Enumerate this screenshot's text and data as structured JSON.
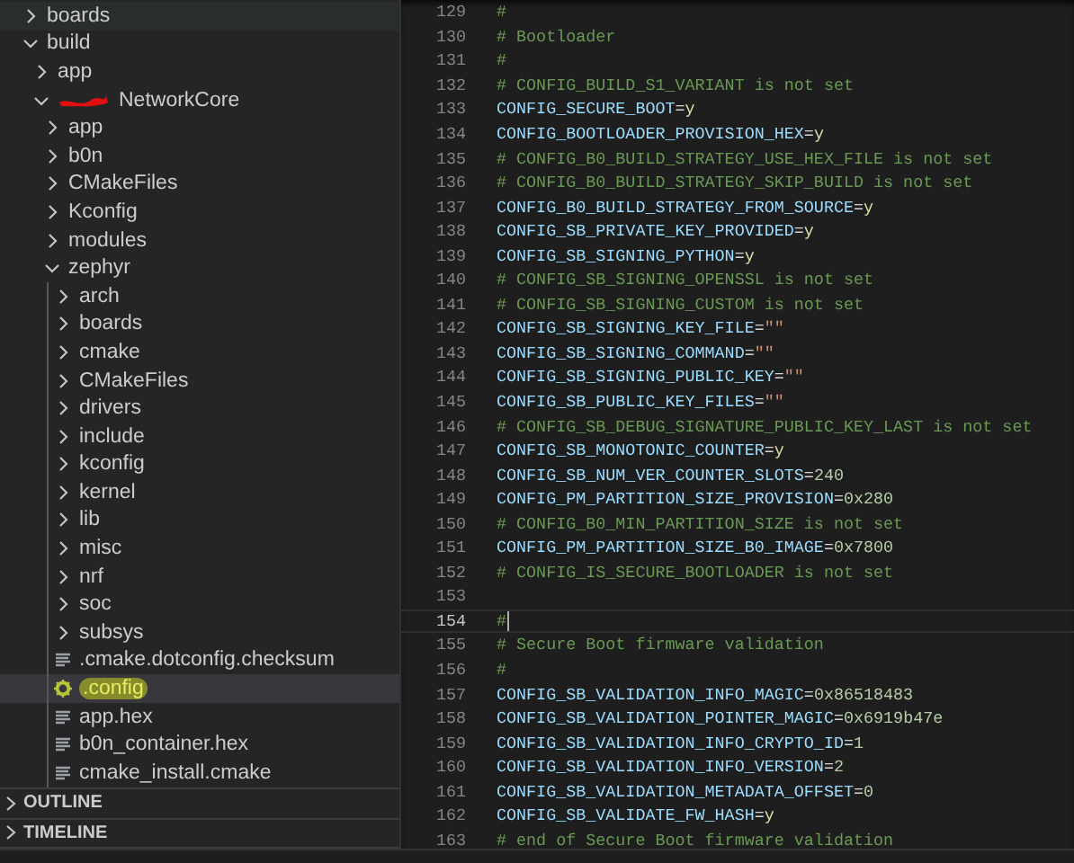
{
  "explorer": {
    "tree": [
      {
        "label": "boards",
        "kind": "folder",
        "expanded": false,
        "hovered": true,
        "selected": false
      },
      {
        "label": "build",
        "kind": "folder",
        "expanded": true,
        "selected": false,
        "children": [
          {
            "label": "app",
            "kind": "folder",
            "expanded": false,
            "selected": false
          },
          {
            "label": "NetworkCore",
            "kind": "folder",
            "expanded": true,
            "redacted": true,
            "selected": false,
            "children": [
              {
                "label": "app",
                "kind": "folder",
                "expanded": false,
                "selected": false
              },
              {
                "label": "b0n",
                "kind": "folder",
                "expanded": false,
                "selected": false
              },
              {
                "label": "CMakeFiles",
                "kind": "folder",
                "expanded": false,
                "selected": false
              },
              {
                "label": "Kconfig",
                "kind": "folder",
                "expanded": false,
                "selected": false
              },
              {
                "label": "modules",
                "kind": "folder",
                "expanded": false,
                "selected": false
              },
              {
                "label": "zephyr",
                "kind": "folder",
                "expanded": true,
                "selected": false,
                "children": [
                  {
                    "label": "arch",
                    "kind": "folder",
                    "expanded": false,
                    "selected": false
                  },
                  {
                    "label": "boards",
                    "kind": "folder",
                    "expanded": false,
                    "selected": false
                  },
                  {
                    "label": "cmake",
                    "kind": "folder",
                    "expanded": false,
                    "selected": false
                  },
                  {
                    "label": "CMakeFiles",
                    "kind": "folder",
                    "expanded": false,
                    "selected": false
                  },
                  {
                    "label": "drivers",
                    "kind": "folder",
                    "expanded": false,
                    "selected": false
                  },
                  {
                    "label": "include",
                    "kind": "folder",
                    "expanded": false,
                    "selected": false
                  },
                  {
                    "label": "kconfig",
                    "kind": "folder",
                    "expanded": false,
                    "selected": false
                  },
                  {
                    "label": "kernel",
                    "kind": "folder",
                    "expanded": false,
                    "selected": false
                  },
                  {
                    "label": "lib",
                    "kind": "folder",
                    "expanded": false,
                    "selected": false
                  },
                  {
                    "label": "misc",
                    "kind": "folder",
                    "expanded": false,
                    "selected": false
                  },
                  {
                    "label": "nrf",
                    "kind": "folder",
                    "expanded": false,
                    "selected": false
                  },
                  {
                    "label": "soc",
                    "kind": "folder",
                    "expanded": false,
                    "selected": false
                  },
                  {
                    "label": "subsys",
                    "kind": "folder",
                    "expanded": false,
                    "selected": false
                  },
                  {
                    "label": ".cmake.dotconfig.checksum",
                    "kind": "file",
                    "selected": false
                  },
                  {
                    "label": ".config",
                    "kind": "settings",
                    "selected": true,
                    "highlighted": true
                  },
                  {
                    "label": "app.hex",
                    "kind": "file",
                    "selected": false
                  },
                  {
                    "label": "b0n_container.hex",
                    "kind": "file",
                    "selected": false
                  },
                  {
                    "label": "cmake_install.cmake",
                    "kind": "file",
                    "selected": false
                  }
                ]
              }
            ]
          }
        ]
      }
    ]
  },
  "panels": [
    {
      "label": "OUTLINE",
      "expanded": false
    },
    {
      "label": "TIMELINE",
      "expanded": false
    }
  ],
  "editor": {
    "lines": [
      {
        "number": "129",
        "current": false,
        "tokens": [
          {
            "kind": "comment",
            "text": "#"
          }
        ]
      },
      {
        "number": "130",
        "current": false,
        "tokens": [
          {
            "kind": "comment",
            "text": "# Bootloader"
          }
        ]
      },
      {
        "number": "131",
        "current": false,
        "tokens": [
          {
            "kind": "comment",
            "text": "#"
          }
        ]
      },
      {
        "number": "132",
        "current": false,
        "tokens": [
          {
            "kind": "comment",
            "text": "# CONFIG_BUILD_S1_VARIANT is not set"
          }
        ]
      },
      {
        "number": "133",
        "current": false,
        "tokens": [
          {
            "kind": "key",
            "text": "CONFIG_SECURE_BOOT"
          },
          {
            "kind": "operator",
            "text": "="
          },
          {
            "kind": "bool",
            "text": "y"
          }
        ]
      },
      {
        "number": "134",
        "current": false,
        "tokens": [
          {
            "kind": "key",
            "text": "CONFIG_BOOTLOADER_PROVISION_HEX"
          },
          {
            "kind": "operator",
            "text": "="
          },
          {
            "kind": "bool",
            "text": "y"
          }
        ]
      },
      {
        "number": "135",
        "current": false,
        "tokens": [
          {
            "kind": "comment",
            "text": "# CONFIG_B0_BUILD_STRATEGY_USE_HEX_FILE is not set"
          }
        ]
      },
      {
        "number": "136",
        "current": false,
        "tokens": [
          {
            "kind": "comment",
            "text": "# CONFIG_B0_BUILD_STRATEGY_SKIP_BUILD is not set"
          }
        ]
      },
      {
        "number": "137",
        "current": false,
        "tokens": [
          {
            "kind": "key",
            "text": "CONFIG_B0_BUILD_STRATEGY_FROM_SOURCE"
          },
          {
            "kind": "operator",
            "text": "="
          },
          {
            "kind": "bool",
            "text": "y"
          }
        ]
      },
      {
        "number": "138",
        "current": false,
        "tokens": [
          {
            "kind": "key",
            "text": "CONFIG_SB_PRIVATE_KEY_PROVIDED"
          },
          {
            "kind": "operator",
            "text": "="
          },
          {
            "kind": "bool",
            "text": "y"
          }
        ]
      },
      {
        "number": "139",
        "current": false,
        "tokens": [
          {
            "kind": "key",
            "text": "CONFIG_SB_SIGNING_PYTHON"
          },
          {
            "kind": "operator",
            "text": "="
          },
          {
            "kind": "bool",
            "text": "y"
          }
        ]
      },
      {
        "number": "140",
        "current": false,
        "tokens": [
          {
            "kind": "comment",
            "text": "# CONFIG_SB_SIGNING_OPENSSL is not set"
          }
        ]
      },
      {
        "number": "141",
        "current": false,
        "tokens": [
          {
            "kind": "comment",
            "text": "# CONFIG_SB_SIGNING_CUSTOM is not set"
          }
        ]
      },
      {
        "number": "142",
        "current": false,
        "tokens": [
          {
            "kind": "key",
            "text": "CONFIG_SB_SIGNING_KEY_FILE"
          },
          {
            "kind": "operator",
            "text": "="
          },
          {
            "kind": "string",
            "text": "\"\""
          }
        ]
      },
      {
        "number": "143",
        "current": false,
        "tokens": [
          {
            "kind": "key",
            "text": "CONFIG_SB_SIGNING_COMMAND"
          },
          {
            "kind": "operator",
            "text": "="
          },
          {
            "kind": "string",
            "text": "\"\""
          }
        ]
      },
      {
        "number": "144",
        "current": false,
        "tokens": [
          {
            "kind": "key",
            "text": "CONFIG_SB_SIGNING_PUBLIC_KEY"
          },
          {
            "kind": "operator",
            "text": "="
          },
          {
            "kind": "string",
            "text": "\"\""
          }
        ]
      },
      {
        "number": "145",
        "current": false,
        "tokens": [
          {
            "kind": "key",
            "text": "CONFIG_SB_PUBLIC_KEY_FILES"
          },
          {
            "kind": "operator",
            "text": "="
          },
          {
            "kind": "string",
            "text": "\"\""
          }
        ]
      },
      {
        "number": "146",
        "current": false,
        "tokens": [
          {
            "kind": "comment",
            "text": "# CONFIG_SB_DEBUG_SIGNATURE_PUBLIC_KEY_LAST is not set"
          }
        ]
      },
      {
        "number": "147",
        "current": false,
        "tokens": [
          {
            "kind": "key",
            "text": "CONFIG_SB_MONOTONIC_COUNTER"
          },
          {
            "kind": "operator",
            "text": "="
          },
          {
            "kind": "bool",
            "text": "y"
          }
        ]
      },
      {
        "number": "148",
        "current": false,
        "tokens": [
          {
            "kind": "key",
            "text": "CONFIG_SB_NUM_VER_COUNTER_SLOTS"
          },
          {
            "kind": "operator",
            "text": "="
          },
          {
            "kind": "number",
            "text": "240"
          }
        ]
      },
      {
        "number": "149",
        "current": false,
        "tokens": [
          {
            "kind": "key",
            "text": "CONFIG_PM_PARTITION_SIZE_PROVISION"
          },
          {
            "kind": "operator",
            "text": "="
          },
          {
            "kind": "number",
            "text": "0x280"
          }
        ]
      },
      {
        "number": "150",
        "current": false,
        "tokens": [
          {
            "kind": "comment",
            "text": "# CONFIG_B0_MIN_PARTITION_SIZE is not set"
          }
        ]
      },
      {
        "number": "151",
        "current": false,
        "tokens": [
          {
            "kind": "key",
            "text": "CONFIG_PM_PARTITION_SIZE_B0_IMAGE"
          },
          {
            "kind": "operator",
            "text": "="
          },
          {
            "kind": "number",
            "text": "0x7800"
          }
        ]
      },
      {
        "number": "152",
        "current": false,
        "tokens": [
          {
            "kind": "comment",
            "text": "# CONFIG_IS_SECURE_BOOTLOADER is not set"
          }
        ]
      },
      {
        "number": "153",
        "current": false
      },
      {
        "number": "154",
        "current": true,
        "tokens": [
          {
            "kind": "comment",
            "text": "#"
          }
        ]
      },
      {
        "number": "155",
        "current": false,
        "tokens": [
          {
            "kind": "comment",
            "text": "# Secure Boot firmware validation"
          }
        ]
      },
      {
        "number": "156",
        "current": false,
        "tokens": [
          {
            "kind": "comment",
            "text": "#"
          }
        ]
      },
      {
        "number": "157",
        "current": false,
        "tokens": [
          {
            "kind": "key",
            "text": "CONFIG_SB_VALIDATION_INFO_MAGIC"
          },
          {
            "kind": "operator",
            "text": "="
          },
          {
            "kind": "number",
            "text": "0x86518483"
          }
        ]
      },
      {
        "number": "158",
        "current": false,
        "tokens": [
          {
            "kind": "key",
            "text": "CONFIG_SB_VALIDATION_POINTER_MAGIC"
          },
          {
            "kind": "operator",
            "text": "="
          },
          {
            "kind": "number",
            "text": "0x6919b47e"
          }
        ]
      },
      {
        "number": "159",
        "current": false,
        "tokens": [
          {
            "kind": "key",
            "text": "CONFIG_SB_VALIDATION_INFO_CRYPTO_ID"
          },
          {
            "kind": "operator",
            "text": "="
          },
          {
            "kind": "number",
            "text": "1"
          }
        ]
      },
      {
        "number": "160",
        "current": false,
        "tokens": [
          {
            "kind": "key",
            "text": "CONFIG_SB_VALIDATION_INFO_VERSION"
          },
          {
            "kind": "operator",
            "text": "="
          },
          {
            "kind": "number",
            "text": "2"
          }
        ]
      },
      {
        "number": "161",
        "current": false,
        "tokens": [
          {
            "kind": "key",
            "text": "CONFIG_SB_VALIDATION_METADATA_OFFSET"
          },
          {
            "kind": "operator",
            "text": "="
          },
          {
            "kind": "number",
            "text": "0"
          }
        ]
      },
      {
        "number": "162",
        "current": false,
        "tokens": [
          {
            "kind": "key",
            "text": "CONFIG_SB_VALIDATE_FW_HASH"
          },
          {
            "kind": "operator",
            "text": "="
          },
          {
            "kind": "bool",
            "text": "y"
          }
        ]
      },
      {
        "number": "163",
        "current": false,
        "tokens": [
          {
            "kind": "comment",
            "text": "# end of Secure Boot firmware validation"
          }
        ]
      }
    ]
  }
}
